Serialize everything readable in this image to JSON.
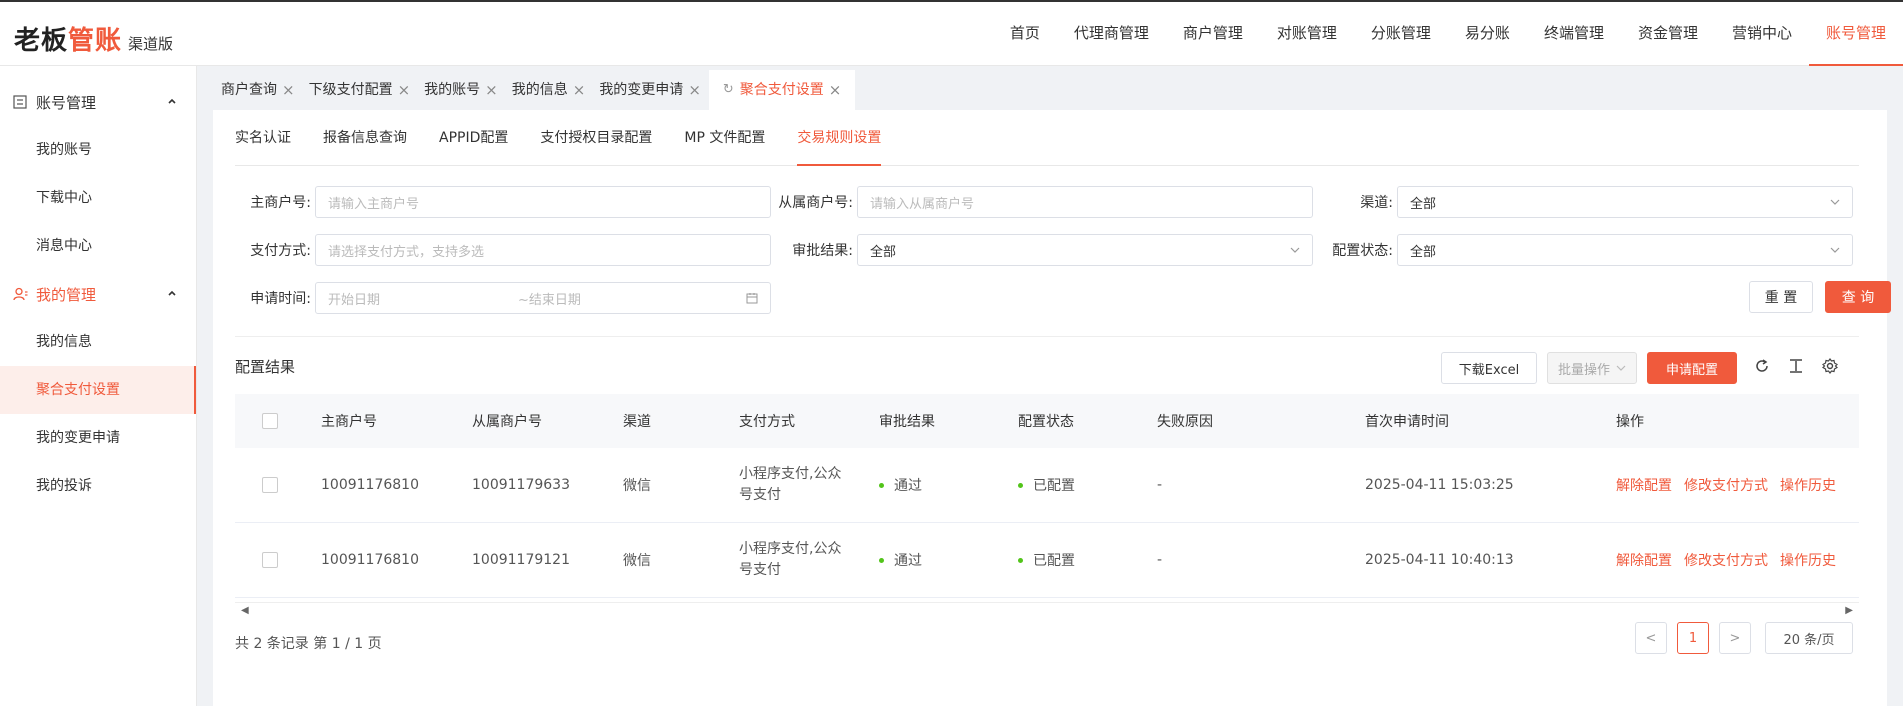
{
  "brand": {
    "logo_part1": "老板",
    "logo_part2": "管账",
    "sub": "渠道版",
    "accent": "#f05a3c"
  },
  "topnav": [
    "首页",
    "代理商管理",
    "商户管理",
    "对账管理",
    "分账管理",
    "易分账",
    "终端管理",
    "资金管理",
    "营销中心",
    "账号管理"
  ],
  "sidebar": {
    "group1": "账号管理",
    "group1_items": [
      "我的账号",
      "下载中心",
      "消息中心"
    ],
    "group2": "我的管理",
    "group2_items": [
      "我的信息",
      "聚合支付设置",
      "我的变更申请",
      "我的投诉"
    ]
  },
  "pagetabs": [
    "商户查询",
    "下级支付配置",
    "我的账号",
    "我的信息",
    "我的变更申请",
    "聚合支付设置"
  ],
  "subtabs": [
    "实名认证",
    "报备信息查询",
    "APPID配置",
    "支付授权目录配置",
    "MP 文件配置",
    "交易规则设置"
  ],
  "filters": {
    "main_merchant_label": "主商户号:",
    "main_merchant_ph": "请输入主商户号",
    "sub_merchant_label": "从属商户号:",
    "sub_merchant_ph": "请输入从属商户号",
    "channel_label": "渠道:",
    "channel_value": "全部",
    "pay_label": "支付方式:",
    "pay_ph": "请选择支付方式，支持多选",
    "approval_label": "审批结果:",
    "approval_value": "全部",
    "config_label": "配置状态:",
    "config_value": "全部",
    "time_label": "申请时间:",
    "start_ph": "开始日期",
    "end_ph": "~结束日期",
    "reset": "重 置",
    "query": "查 询"
  },
  "results": {
    "title": "配置结果",
    "download": "下载Excel",
    "batch": "批量操作",
    "apply": "申请配置"
  },
  "table": {
    "headers": [
      "主商户号",
      "从属商户号",
      "渠道",
      "支付方式",
      "审批结果",
      "配置状态",
      "失败原因",
      "首次申请时间",
      "操作"
    ],
    "rows": [
      {
        "main": "10091176810",
        "sub": "10091179633",
        "channel": "微信",
        "pay1": "小程序支付,公众",
        "pay2": "号支付",
        "approval": "通过",
        "config": "已配置",
        "reason": "-",
        "time": "2025-04-11 15:03:25"
      },
      {
        "main": "10091176810",
        "sub": "10091179121",
        "channel": "微信",
        "pay1": "小程序支付,公众",
        "pay2": "号支付",
        "approval": "通过",
        "config": "已配置",
        "reason": "-",
        "time": "2025-04-11 10:40:13"
      }
    ],
    "ops": [
      "解除配置",
      "修改支付方式",
      "操作历史"
    ]
  },
  "footer": {
    "summary": "共 2 条记录 第 1 / 1 页",
    "page": "1",
    "prev": "<",
    "next": ">",
    "size": "20 条/页"
  }
}
